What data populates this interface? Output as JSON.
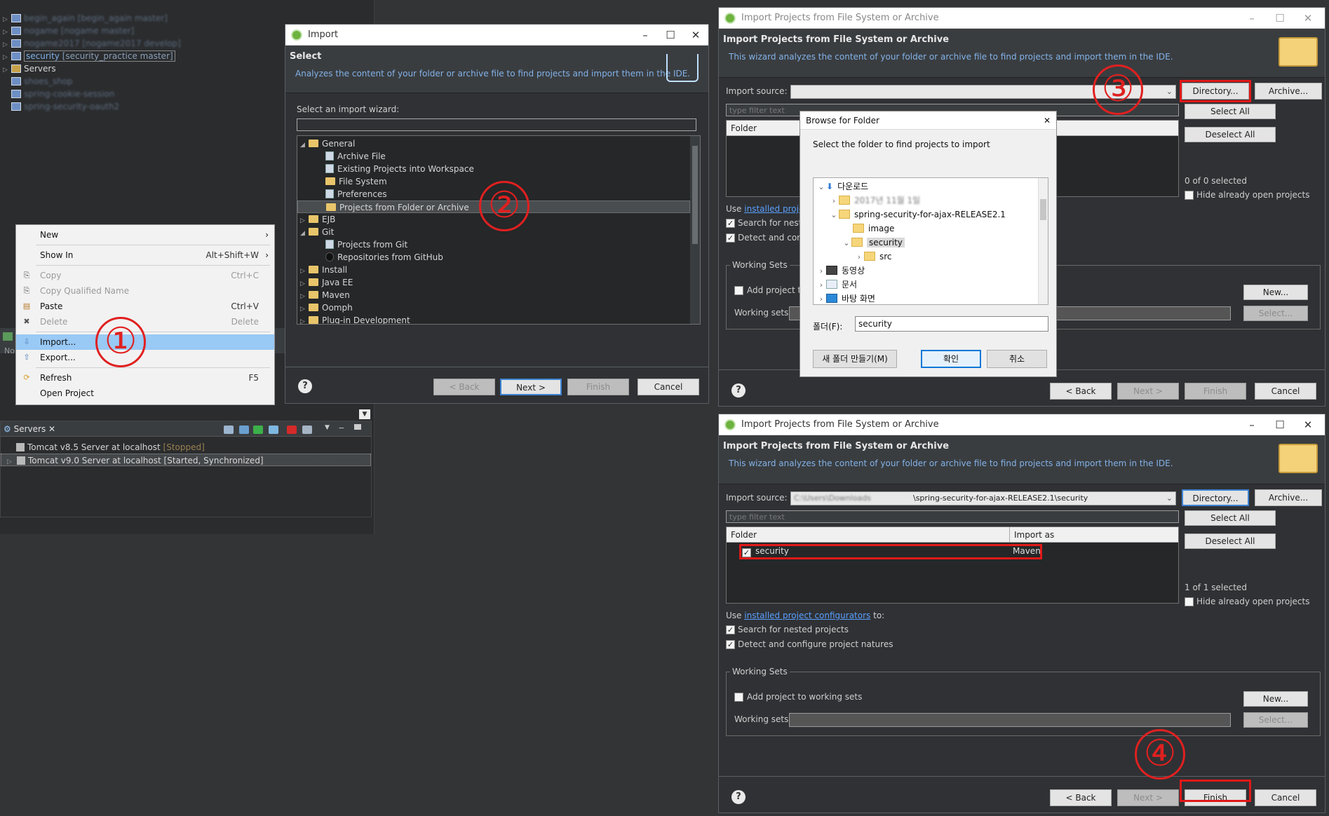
{
  "workspace": {
    "projects": [
      {
        "name": "begin_again",
        "branch": "[begin_again master]"
      },
      {
        "name": "nogame",
        "branch": "[nogame master]"
      },
      {
        "name": "nogame2017",
        "branch": "[nogame2017 develop]"
      },
      {
        "name": "security",
        "branch": "[security_practice master]"
      }
    ],
    "folders": [
      "Servers",
      "shoes_shop",
      "spring-cookie-session",
      "spring-security-oauth2"
    ]
  },
  "context_menu": {
    "items": [
      {
        "label": "New",
        "shortcut": "",
        "submenu": true,
        "disabled": false
      },
      {
        "label": "Show In",
        "shortcut": "Alt+Shift+W",
        "submenu": true,
        "disabled": false
      },
      {
        "label": "Copy",
        "shortcut": "Ctrl+C",
        "submenu": false,
        "disabled": true
      },
      {
        "label": "Copy Qualified Name",
        "shortcut": "",
        "submenu": false,
        "disabled": true
      },
      {
        "label": "Paste",
        "shortcut": "Ctrl+V",
        "submenu": false,
        "disabled": false
      },
      {
        "label": "Delete",
        "shortcut": "Delete",
        "submenu": false,
        "disabled": true
      },
      {
        "label": "Import...",
        "shortcut": "",
        "submenu": false,
        "disabled": false,
        "selected": true
      },
      {
        "label": "Export...",
        "shortcut": "",
        "submenu": false,
        "disabled": false
      },
      {
        "label": "Refresh",
        "shortcut": "F5",
        "submenu": false,
        "disabled": false
      },
      {
        "label": "Open Project",
        "shortcut": "",
        "submenu": false,
        "disabled": false
      }
    ],
    "partial_label": "No"
  },
  "servers_view": {
    "tab_label": "Servers",
    "rows": [
      {
        "name": "Tomcat v8.5 Server at localhost",
        "status": "[Stopped]"
      },
      {
        "name": "Tomcat v9.0 Server at localhost",
        "status": "[Started, Synchronized]"
      }
    ]
  },
  "import_dialog": {
    "title": "Import",
    "header_title": "Select",
    "header_desc": "Analyzes the content of your folder or archive file to find projects and import them in the IDE.",
    "filter_label": "Select an import wizard:",
    "tree": [
      {
        "label": "General",
        "level": 0,
        "expanded": true
      },
      {
        "label": "Archive File",
        "level": 1
      },
      {
        "label": "Existing Projects into Workspace",
        "level": 1
      },
      {
        "label": "File System",
        "level": 1
      },
      {
        "label": "Preferences",
        "level": 1
      },
      {
        "label": "Projects from Folder or Archive",
        "level": 1,
        "selected": true
      },
      {
        "label": "EJB",
        "level": 0
      },
      {
        "label": "Git",
        "level": 0,
        "expanded": true
      },
      {
        "label": "Projects from Git",
        "level": 1
      },
      {
        "label": "Repositories from GitHub",
        "level": 1
      },
      {
        "label": "Install",
        "level": 0
      },
      {
        "label": "Java EE",
        "level": 0
      },
      {
        "label": "Maven",
        "level": 0
      },
      {
        "label": "Oomph",
        "level": 0
      },
      {
        "label": "Plug-in Development",
        "level": 0
      }
    ],
    "buttons": {
      "back": "< Back",
      "next": "Next >",
      "finish": "Finish",
      "cancel": "Cancel"
    }
  },
  "ipfs_dialog": {
    "title": "Import Projects from File System or Archive",
    "header_title": "Import Projects from File System or Archive",
    "header_desc": "This wizard analyzes the content of your folder or archive file to find projects and import them in the IDE.",
    "import_source_label": "Import source:",
    "directory_label": "Directory...",
    "archive_label": "Archive...",
    "select_all": "Select All",
    "deselect_all": "Deselect All",
    "folder_col": "Folder",
    "import_as_col": "Import as",
    "hide_open": "Hide already open projects",
    "use_prefix": "Use",
    "configurators_link": "installed project configurators",
    "use_suffix": "to:",
    "search_nested": "Search for nested projects",
    "detect_natures": "Detect and configure project natures",
    "working_sets_label": "Working Sets",
    "add_to_ws": "Add project to working sets",
    "working_sets_field": "Working sets:",
    "new_label": "New...",
    "select_label": "Select...",
    "filter_placeholder": "type filter text",
    "buttons": {
      "back": "< Back",
      "next": "Next >",
      "finish": "Finish",
      "cancel": "Cancel"
    },
    "top": {
      "selected_count": "0 of 0 selected",
      "source_value": ""
    },
    "bottom": {
      "selected_count": "1 of 1 selected",
      "source_value": "\\spring-security-for-ajax-RELEASE2.1\\security",
      "row_folder": "security",
      "row_import_as": "Maven"
    }
  },
  "browse_dialog": {
    "title": "Browse for Folder",
    "prompt": "Select the folder to find projects to import",
    "tree": [
      {
        "label": "다운로드",
        "level": 0
      },
      {
        "label": "2017년 11월 1일",
        "level": 1
      },
      {
        "label": "spring-security-for-ajax-RELEASE2.1",
        "level": 1
      },
      {
        "label": "image",
        "level": 2
      },
      {
        "label": "security",
        "level": 2,
        "selected": true
      },
      {
        "label": "src",
        "level": 3
      },
      {
        "label": "동영상",
        "level": 0
      },
      {
        "label": "문서",
        "level": 0
      },
      {
        "label": "바탕 화면",
        "level": 0
      }
    ],
    "folder_label": "폴더(F):",
    "folder_value": "security",
    "new_folder": "새 폴더 만들기(M)",
    "ok": "확인",
    "cancel": "취소"
  },
  "steps": [
    "①",
    "②",
    "③",
    "④"
  ],
  "colors": {
    "accent_red": "#e01818",
    "selection_blue": "#99c9f5",
    "spring_green": "#6db33f",
    "link_blue": "#5aa0ff"
  }
}
